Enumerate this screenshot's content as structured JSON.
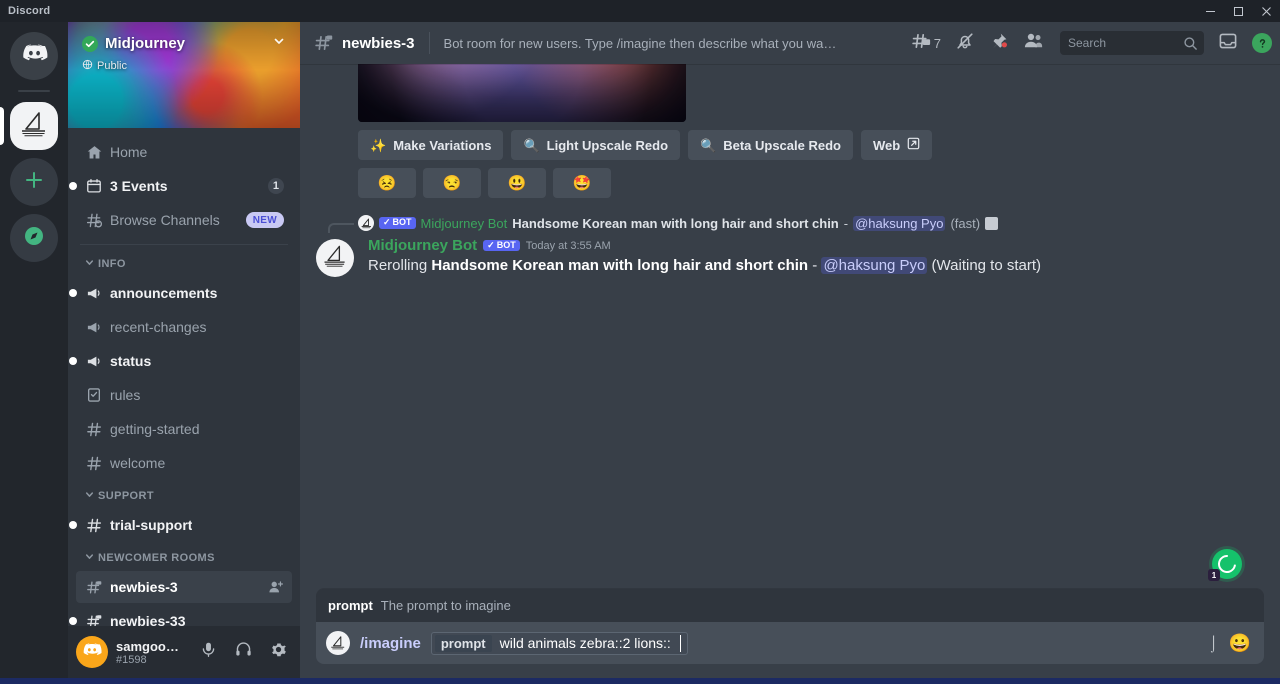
{
  "window": {
    "brand": "Discord",
    "minimize_label": "Minimize",
    "maximize_label": "Maximize",
    "close_label": "Close"
  },
  "rail": {
    "items": [
      {
        "name": "direct-messages",
        "icon": "discord-logo-icon",
        "active": false
      },
      {
        "name": "midjourney-server",
        "icon": "midjourney-sailboat-icon",
        "active": true
      },
      {
        "name": "add-server",
        "icon": "plus-icon",
        "active": false
      },
      {
        "name": "explore-servers",
        "icon": "compass-icon",
        "active": false
      }
    ]
  },
  "server": {
    "name": "Midjourney",
    "verified_icon": "verified-check-icon",
    "visibility": "Public",
    "visibility_icon": "globe-icon",
    "chevron_icon": "chevron-down-icon"
  },
  "sidebar": {
    "nav": [
      {
        "label": "Home",
        "icon": "home-icon",
        "badge": "",
        "badge_type": "none",
        "unread": false,
        "strong": false
      },
      {
        "label": "3 Events",
        "icon": "calendar-icon",
        "badge": "1",
        "badge_type": "count",
        "unread": true,
        "strong": true
      },
      {
        "label": "Browse Channels",
        "icon": "browse-channels-icon",
        "badge": "NEW",
        "badge_type": "new",
        "unread": false,
        "strong": false
      }
    ],
    "categories": [
      {
        "label": "INFO",
        "chevron_icon": "chevron-down-icon",
        "channels": [
          {
            "label": "announcements",
            "icon": "announcement-icon",
            "unread": true,
            "strong": true,
            "selected": false,
            "badge": ""
          },
          {
            "label": "recent-changes",
            "icon": "announcement-icon",
            "unread": false,
            "strong": false,
            "selected": false,
            "badge": ""
          },
          {
            "label": "status",
            "icon": "announcement-icon",
            "unread": true,
            "strong": true,
            "selected": false,
            "badge": ""
          },
          {
            "label": "rules",
            "icon": "rules-icon",
            "unread": false,
            "strong": false,
            "selected": false,
            "badge": ""
          },
          {
            "label": "getting-started",
            "icon": "hash-icon",
            "unread": false,
            "strong": false,
            "selected": false,
            "badge": ""
          },
          {
            "label": "welcome",
            "icon": "hash-icon",
            "unread": false,
            "strong": false,
            "selected": false,
            "badge": ""
          }
        ]
      },
      {
        "label": "SUPPORT",
        "chevron_icon": "chevron-down-icon",
        "channels": [
          {
            "label": "trial-support",
            "icon": "hash-icon",
            "unread": true,
            "strong": true,
            "selected": false,
            "badge": ""
          }
        ]
      },
      {
        "label": "NEWCOMER ROOMS",
        "chevron_icon": "chevron-down-icon",
        "channels": [
          {
            "label": "newbies-3",
            "icon": "hash-thread-icon",
            "unread": false,
            "strong": true,
            "selected": true,
            "badge": "invite"
          },
          {
            "label": "newbies-33",
            "icon": "hash-thread-icon",
            "unread": true,
            "strong": true,
            "selected": false,
            "badge": ""
          }
        ]
      }
    ]
  },
  "user_panel": {
    "username": "samgoodw...",
    "discriminator": "#1598",
    "avatar_icon": "discord-avatar-icon",
    "controls": [
      {
        "name": "mute-microphone-button",
        "icon": "microphone-icon"
      },
      {
        "name": "deafen-button",
        "icon": "headphones-icon"
      },
      {
        "name": "user-settings-button",
        "icon": "gear-icon"
      }
    ]
  },
  "channel_header": {
    "hash_icon": "hash-thread-icon",
    "name": "newbies-3",
    "topic": "Bot room for new users. Type /imagine then describe what you want to draw. S...",
    "threads_icon": "threads-icon",
    "threads_count": "7",
    "notifications_icon": "bell-muted-icon",
    "pinned_icon": "pin-icon",
    "members_icon": "members-icon",
    "inbox_icon": "inbox-icon",
    "help_icon": "help-icon"
  },
  "search": {
    "placeholder": "Search",
    "value": "",
    "icon": "search-icon"
  },
  "attachment": {
    "alt": "Midjourney generated cosmic portrait",
    "width": "328",
    "height": "330"
  },
  "action_buttons": [
    {
      "label": "Make Variations",
      "icon": "sparkles-icon"
    },
    {
      "label": "Light Upscale Redo",
      "icon": "magnifier-icon"
    },
    {
      "label": "Beta Upscale Redo",
      "icon": "magnifier-icon"
    },
    {
      "label": "Web",
      "icon": "external-link-icon"
    }
  ],
  "reaction_buttons": [
    {
      "emoji": "😣",
      "name": "persevere-emoji"
    },
    {
      "emoji": "😒",
      "name": "unamused-emoji"
    },
    {
      "emoji": "😃",
      "name": "grinning-emoji"
    },
    {
      "emoji": "🤩",
      "name": "star-struck-emoji"
    }
  ],
  "reply_context": {
    "bot_tag": "BOT",
    "bot_check": "✓",
    "author": "Midjourney Bot",
    "prompt": "Handsome Korean man with long hair and short chin",
    "dash": "-",
    "mention": "@haksung Pyo",
    "speed": "(fast)",
    "attachment_icon": "image-attachment-icon"
  },
  "message": {
    "author": "Midjourney Bot",
    "bot_tag": "BOT",
    "bot_check": "✓",
    "timestamp": "Today at 3:55 AM",
    "prefix": "Rerolling ",
    "prompt": "Handsome Korean man with long hair and short chin",
    "dash": " - ",
    "mention": "@haksung Pyo",
    "status": " (Waiting to start)"
  },
  "suggestion": {
    "key": "prompt",
    "description": "The prompt to imagine"
  },
  "composer": {
    "avatar_icon": "midjourney-sailboat-icon",
    "command": "/imagine",
    "field_name": "prompt",
    "field_value": "wild animals zebra::2 lions::",
    "emoji_icon": "emoji-picker-icon",
    "grammarly_icon": "grammarly-icon",
    "grammarly_badge": "1"
  },
  "colors": {
    "brand_blurple": "#5865f2",
    "green": "#3ba55d",
    "chat_bg": "#383f48",
    "sidebar_bg": "#2f353d",
    "rail_bg": "#22262c",
    "mention": "#c9cdfb",
    "grammarly_green": "#15c26b",
    "new_badge": "#c9c9f4"
  }
}
